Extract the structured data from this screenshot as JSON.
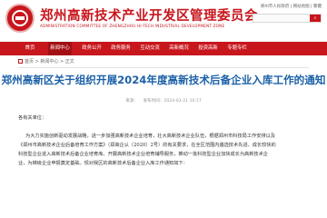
{
  "header": {
    "title": "郑州高新技术产业开发区管理委员会",
    "subtitle": "ADMINISTRATION COMMITTEE OF ZHENGZHOU HI-TECH INDUSTRIAL DEVELOPMENT ZONE",
    "tool_links": "郑州市人民政府 | 网站地图 | 繁體",
    "search_placeholder": "",
    "search_icon": "search-icon"
  },
  "nav": {
    "items": [
      "首页",
      "新闻中心",
      "政务公开",
      "政务服务",
      "互动交流",
      "高新概况",
      "投资高新",
      "专题专栏"
    ],
    "active_index": 1,
    "color": "#c8161d"
  },
  "breadcrumb": "首页 > 新闻中心 > 正文",
  "article": {
    "title": "郑州高新区关于组织开展2024年度高新技术后备企业入库工作的通知",
    "source": "来源：",
    "time": "发布时间：2024-03-21 10:17",
    "salutation": "各有关单位：",
    "paragraphs": [
      "为大力实施创新驱动发展战略，进一步加强高新技术企业培育，壮大高新技术企业队伍，根据郑州市科技局工作安排以及",
      "《郑州市高新技术企业后备培育工作方案》（郑高企认〔2020〕2号）的有关要求，在全区范围内遴选技术先进、成长较快的",
      "科技型企业进入高新技术后备企业培育库。开展高新技术企业培育辅导服务，推动一批科技型企业加快成长为高新技术企",
      "业，为梯级企业申报奠定基础。现对我区的高新技术后备企业入库工作通知如下："
    ]
  }
}
